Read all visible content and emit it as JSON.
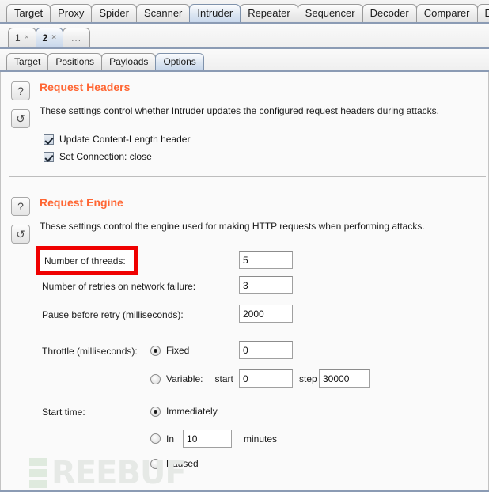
{
  "top_tabs": [
    {
      "label": "Target",
      "selected": false
    },
    {
      "label": "Proxy",
      "selected": false
    },
    {
      "label": "Spider",
      "selected": false
    },
    {
      "label": "Scanner",
      "selected": false
    },
    {
      "label": "Intruder",
      "selected": true
    },
    {
      "label": "Repeater",
      "selected": false
    },
    {
      "label": "Sequencer",
      "selected": false
    },
    {
      "label": "Decoder",
      "selected": false
    },
    {
      "label": "Comparer",
      "selected": false
    },
    {
      "label": "Exten",
      "selected": false
    }
  ],
  "attack_tabs": [
    {
      "label": "1",
      "close": "×",
      "selected": false
    },
    {
      "label": "2",
      "close": "×",
      "selected": true
    },
    {
      "label": "...",
      "close": "",
      "selected": false
    }
  ],
  "sub_tabs": [
    {
      "label": "Target",
      "selected": false
    },
    {
      "label": "Positions",
      "selected": false
    },
    {
      "label": "Payloads",
      "selected": false
    },
    {
      "label": "Options",
      "selected": true
    }
  ],
  "request_headers": {
    "help_icon": "?",
    "reset_icon": "↺",
    "title": "Request Headers",
    "description": "These settings control whether Intruder updates the configured request headers during attacks.",
    "checkboxes": [
      {
        "label": "Update Content-Length header",
        "checked": true
      },
      {
        "label": "Set Connection: close",
        "checked": true
      }
    ]
  },
  "request_engine": {
    "help_icon": "?",
    "reset_icon": "↺",
    "title": "Request Engine",
    "description": "These settings control the engine used for making HTTP requests when performing attacks.",
    "threads": {
      "label": "Number of threads:",
      "value": "5",
      "annotated": true
    },
    "retries": {
      "label": "Number of retries on network failure:",
      "value": "3"
    },
    "pause": {
      "label": "Pause before retry (milliseconds):",
      "value": "2000"
    },
    "throttle": {
      "label": "Throttle (milliseconds):",
      "fixed_label": "Fixed",
      "fixed_selected": true,
      "fixed_value": "0",
      "variable_label": "Variable:",
      "variable_selected": false,
      "start_label": "start",
      "start_value": "0",
      "step_label": "step",
      "step_value": "30000"
    },
    "start_time": {
      "label": "Start time:",
      "options": [
        {
          "label": "Immediately",
          "selected": true
        },
        {
          "label": "In",
          "selected": false,
          "value": "10",
          "suffix": "minutes"
        },
        {
          "label": "Paused",
          "selected": false
        }
      ]
    }
  },
  "watermark": {
    "text": "REEBUF"
  },
  "colors": {
    "accent": "#ff6633",
    "annotation": "#ef0000",
    "tab_selected": "#c9d8ec"
  }
}
